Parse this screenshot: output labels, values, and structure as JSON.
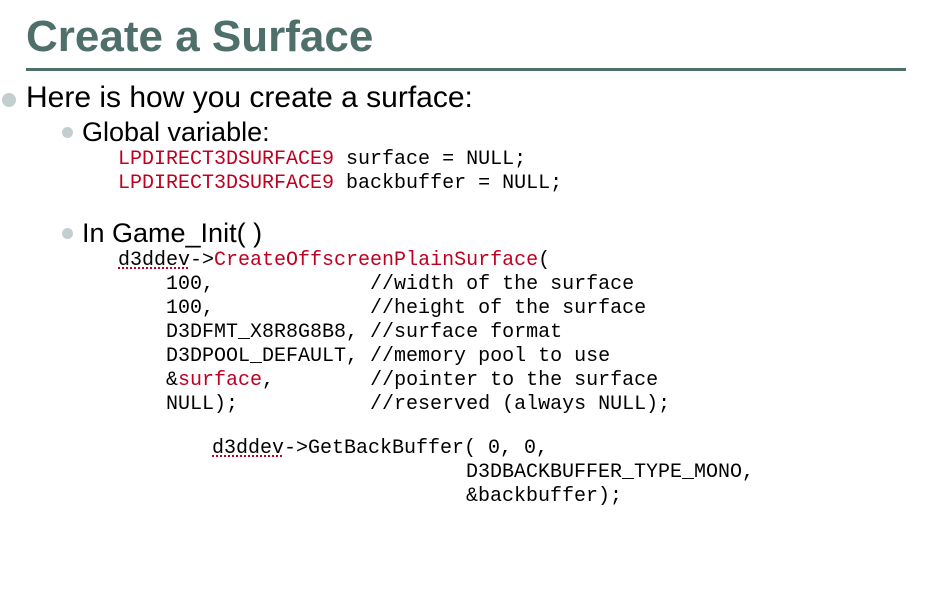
{
  "title": "Create a Surface",
  "bullet_main": "Here is how you create a surface:",
  "sub1": "Global variable:",
  "global1_type": "LPDIRECT3DSURFACE9",
  "global1_rest": " surface = NULL;",
  "global2_type": "LPDIRECT3DSURFACE9",
  "global2_rest": " backbuffer = NULL;",
  "sub2": "In Game_Init( )",
  "call_obj": "d3ddev",
  "call_arrow": "->",
  "call_method": "CreateOffscreenPlainSurface",
  "call_open": "(",
  "arg1_val": "    100,             ",
  "arg1_comment": "//width of the surface",
  "arg2_val": "    100,             ",
  "arg2_comment": "//height of the surface",
  "arg3_val": "    D3DFMT_X8R8G8B8, ",
  "arg3_comment": "//surface format",
  "arg4_val": "    D3DPOOL_DEFAULT, ",
  "arg4_comment": "//memory pool to use",
  "arg5_pre": "    &",
  "arg5_name": "surface",
  "arg5_post": ",        ",
  "arg5_comment": "//pointer to the surface",
  "arg6_val": "    NULL);           ",
  "arg6_comment": "//reserved (always NULL);",
  "bb_obj": "d3ddev",
  "bb_rest1": "->GetBackBuffer( 0, 0,",
  "bb_line2": "D3DBACKBUFFER_TYPE_MONO,",
  "bb_line3": "&backbuffer);"
}
